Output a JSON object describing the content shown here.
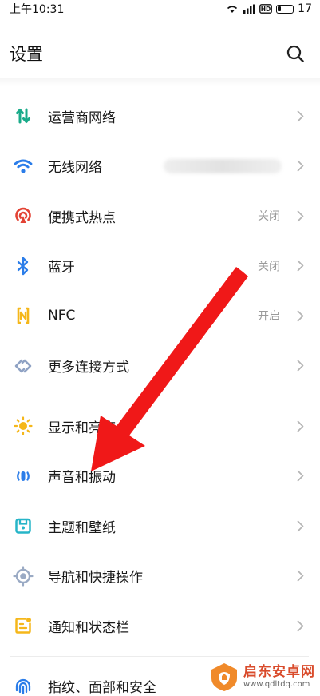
{
  "status_bar": {
    "time": "上午10:31",
    "battery": "17"
  },
  "header": {
    "title": "设置"
  },
  "colors": {
    "accent_green": "#1aab8a",
    "accent_blue": "#2b7de9",
    "accent_red": "#e34234",
    "accent_yellow": "#f5b71a",
    "accent_teal": "#27b5c8",
    "annotation_arrow": "#f01818",
    "chevron": "#b5b5b5"
  },
  "groups": [
    {
      "items": [
        {
          "label": "运营商网络",
          "value": "",
          "icon": "carrier-network-icon"
        },
        {
          "label": "无线网络",
          "value": "",
          "icon": "wifi-icon",
          "value_obscured": true
        },
        {
          "label": "便携式热点",
          "value": "关闭",
          "icon": "hotspot-icon"
        },
        {
          "label": "蓝牙",
          "value": "关闭",
          "icon": "bluetooth-icon"
        },
        {
          "label": "NFC",
          "value": "开启",
          "icon": "nfc-icon"
        },
        {
          "label": "更多连接方式",
          "value": "",
          "icon": "more-connections-icon"
        }
      ]
    },
    {
      "items": [
        {
          "label": "显示和亮度",
          "value": "",
          "icon": "display-brightness-icon"
        },
        {
          "label": "声音和振动",
          "value": "",
          "icon": "sound-vibration-icon"
        },
        {
          "label": "主题和壁纸",
          "value": "",
          "icon": "theme-wallpaper-icon"
        },
        {
          "label": "导航和快捷操作",
          "value": "",
          "icon": "navigation-icon"
        },
        {
          "label": "通知和状态栏",
          "value": "",
          "icon": "notification-icon"
        }
      ]
    },
    {
      "items": [
        {
          "label": "指纹、面部和安全",
          "value": "",
          "icon": "fingerprint-icon"
        }
      ]
    }
  ],
  "watermark": {
    "title": "启东安卓网",
    "url": "www.qdltdq.com"
  }
}
